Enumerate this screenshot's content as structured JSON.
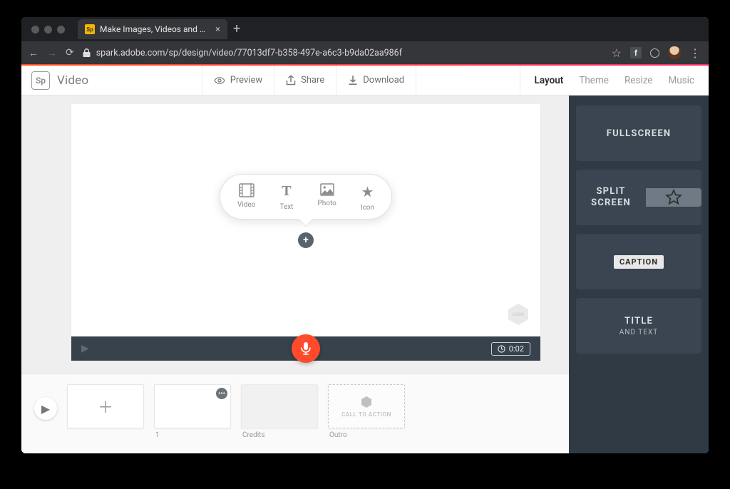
{
  "browser": {
    "tab_title": "Make Images, Videos and Web…",
    "url": "spark.adobe.com/sp/design/video/77013df7-b358-497e-a6c3-b9da02aa986f"
  },
  "app": {
    "brand_badge": "Sp",
    "brand_name": "Video",
    "toolbar": {
      "preview": "Preview",
      "share": "Share",
      "download": "Download"
    },
    "tabs": {
      "layout": "Layout",
      "theme": "Theme",
      "resize": "Resize",
      "music": "Music"
    }
  },
  "insert": {
    "video": "Video",
    "text": "Text",
    "photo": "Photo",
    "icon": "Icon"
  },
  "playback": {
    "duration": "0:02"
  },
  "tray": {
    "slide1_index": "1",
    "credits": "Credits",
    "outro": "Outro",
    "cta": "CALL TO ACTION"
  },
  "layouts": {
    "fullscreen": "FULLSCREEN",
    "split1": "SPLIT",
    "split2": "SCREEN",
    "caption": "CAPTION",
    "title": "TITLE",
    "title_sub": "AND TEXT"
  }
}
